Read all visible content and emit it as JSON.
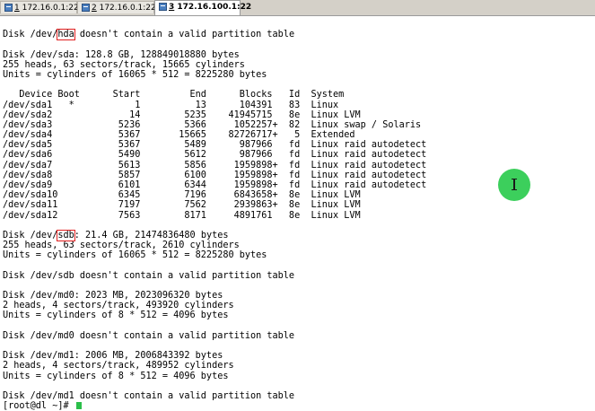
{
  "tabs": [
    {
      "number": "1",
      "label": "172.16.0.1:22"
    },
    {
      "number": "2",
      "label": "172.16.0.1:22"
    },
    {
      "number": "3",
      "label": "172.16.100.1:22"
    }
  ],
  "active_tab_index": 2,
  "accent_colors": {
    "highlight_box": "#e02020",
    "cursor": "#2bbf4a"
  },
  "terminal": {
    "lines": [
      "",
      "Disk /dev/hda doesn't contain a valid partition table",
      "",
      "Disk /dev/sda: 128.8 GB, 128849018880 bytes",
      "255 heads, 63 sectors/track, 15665 cylinders",
      "Units = cylinders of 16065 * 512 = 8225280 bytes",
      "",
      "   Device Boot      Start         End      Blocks   Id  System",
      "/dev/sda1   *           1          13      104391   83  Linux",
      "/dev/sda2              14        5235    41945715   8e  Linux LVM",
      "/dev/sda3            5236        5366     1052257+  82  Linux swap / Solaris",
      "/dev/sda4            5367       15665    82726717+   5  Extended",
      "/dev/sda5            5367        5489      987966   fd  Linux raid autodetect",
      "/dev/sda6            5490        5612      987966   fd  Linux raid autodetect",
      "/dev/sda7            5613        5856     1959898+  fd  Linux raid autodetect",
      "/dev/sda8            5857        6100     1959898+  fd  Linux raid autodetect",
      "/dev/sda9            6101        6344     1959898+  fd  Linux raid autodetect",
      "/dev/sda10           6345        7196     6843658+  8e  Linux LVM",
      "/dev/sda11           7197        7562     2939863+  8e  Linux LVM",
      "/dev/sda12           7563        8171     4891761   8e  Linux LVM",
      "",
      "Disk /dev/sdb: 21.4 GB, 21474836480 bytes",
      "255 heads, 63 sectors/track, 2610 cylinders",
      "Units = cylinders of 16065 * 512 = 8225280 bytes",
      "",
      "Disk /dev/sdb doesn't contain a valid partition table",
      "",
      "Disk /dev/md0: 2023 MB, 2023096320 bytes",
      "2 heads, 4 sectors/track, 493920 cylinders",
      "Units = cylinders of 8 * 512 = 4096 bytes",
      "",
      "Disk /dev/md0 doesn't contain a valid partition table",
      "",
      "Disk /dev/md1: 2006 MB, 2006843392 bytes",
      "2 heads, 4 sectors/track, 489952 cylinders",
      "Units = cylinders of 8 * 512 = 4096 bytes",
      "",
      "Disk /dev/md1 doesn't contain a valid partition table",
      "[root@dl ~]# "
    ],
    "highlighted_tokens": [
      {
        "line": 1,
        "text": "hda"
      },
      {
        "line": 21,
        "text": "sdb"
      }
    ]
  }
}
